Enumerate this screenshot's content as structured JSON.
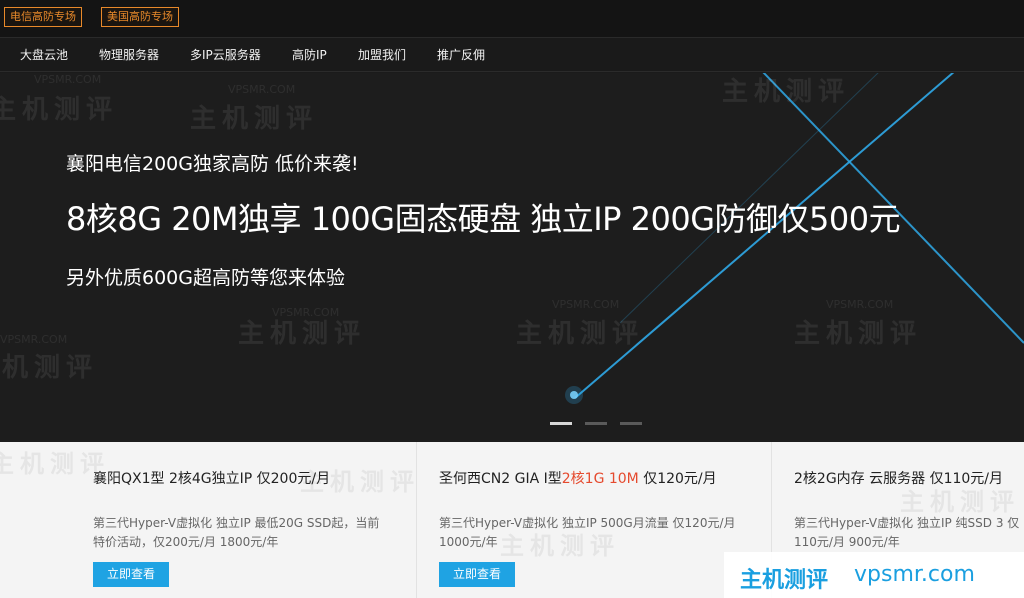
{
  "topbar": {
    "tags": [
      "电信高防专场",
      "美国高防专场"
    ]
  },
  "nav": {
    "items": [
      "大盘云池",
      "物理服务器",
      "多IP云服务器",
      "高防IP",
      "加盟我们",
      "推广反佣"
    ]
  },
  "hero": {
    "line1": "襄阳电信200G独家高防 低价来袭!",
    "line2": "8核8G 20M独享 100G固态硬盘 独立IP 200G防御仅500元",
    "line3": "另外优质600G超高防等您来体验",
    "slides": 3,
    "active_slide": 1
  },
  "cards": [
    {
      "title": "襄阳QX1型 2核4G独立IP 仅200元/月",
      "desc": "第三代Hyper-V虚拟化 独立IP 最低20G SSD起，当前特价活动，仅200元/月 1800元/年",
      "button": "立即查看"
    },
    {
      "title_pre": "圣何西CN2 GIA I型",
      "title_red": "2核1G 10M",
      "title_post": " 仅120元/月",
      "desc": "第三代Hyper-V虚拟化 独立IP 500G月流量 仅120元/月  1000元/年",
      "button": "立即查看"
    },
    {
      "title": "2核2G内存 云服务器 仅110元/月",
      "desc": "第三代Hyper-V虚拟化 独立IP 纯SSD 3 仅110元/月 900元/年"
    }
  ],
  "watermark": {
    "cn": "主机测评",
    "en": "VPSMR.COM"
  },
  "site_badge": {
    "cn": "主机测评",
    "en": "vpsmr.com"
  },
  "colors": {
    "accent_orange": "#e8892a",
    "button_blue": "#1fa3e3",
    "highlight_red": "#e54a2e",
    "light_line": "#2fa9e8"
  }
}
